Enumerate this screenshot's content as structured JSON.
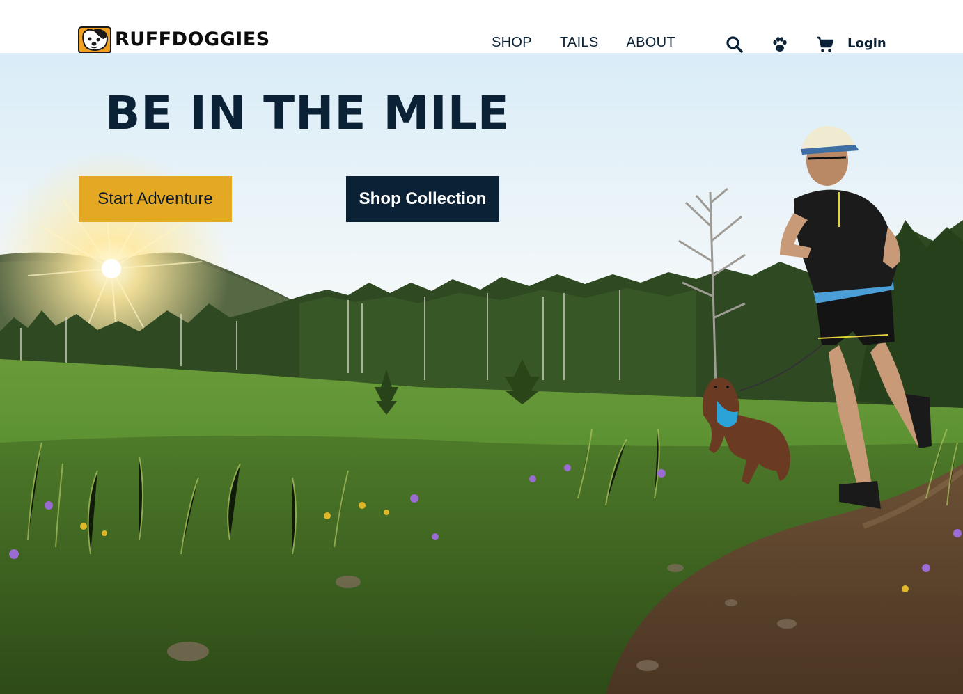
{
  "brand": {
    "name": "RUFFDOGGIES",
    "accent_color": "#e5a823",
    "navy_color": "#0b2236"
  },
  "nav": {
    "items": [
      {
        "label": "SHOP"
      },
      {
        "label": "TAILS"
      },
      {
        "label": "ABOUT"
      }
    ],
    "icons": [
      "search-icon",
      "paw-icon",
      "cart-icon"
    ],
    "login_label": "Login"
  },
  "hero": {
    "headline": "BE IN THE MILE",
    "primary_cta": "Start Adventure",
    "secondary_cta": "Shop Collection",
    "image_description_icons": [
      "sunrise-over-mountain",
      "forest",
      "meadow",
      "runner",
      "dog",
      "dirt-trail"
    ]
  }
}
